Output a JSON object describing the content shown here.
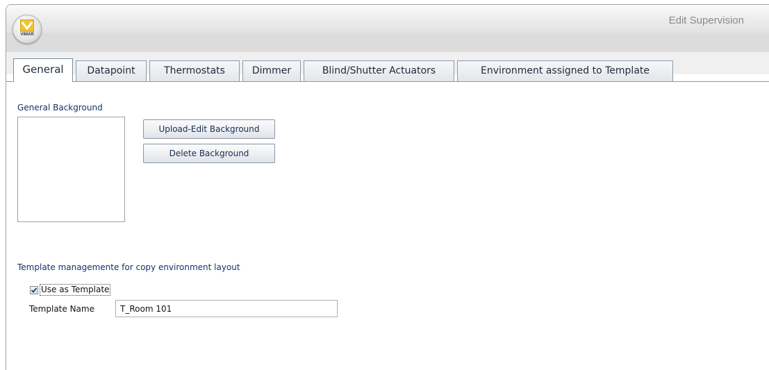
{
  "window": {
    "title": "Edit Supervision"
  },
  "logo": {
    "text": "VIMAR"
  },
  "tabs": [
    {
      "label": "General",
      "active": true
    },
    {
      "label": "Datapoint",
      "active": false
    },
    {
      "label": "Thermostats",
      "active": false
    },
    {
      "label": "Dimmer",
      "active": false
    },
    {
      "label": "Blind/Shutter Actuators",
      "active": false
    },
    {
      "label": "Environment assigned to Template",
      "active": false
    }
  ],
  "general": {
    "background_label": "General Background",
    "upload_button": "Upload-Edit Background",
    "delete_button": "Delete Background"
  },
  "template": {
    "section_label": "Template managemente for copy environment layout",
    "use_as_template_label": "Use as Template",
    "use_as_template_checked": true,
    "name_label": "Template Name",
    "name_value": "T_Room 101"
  }
}
